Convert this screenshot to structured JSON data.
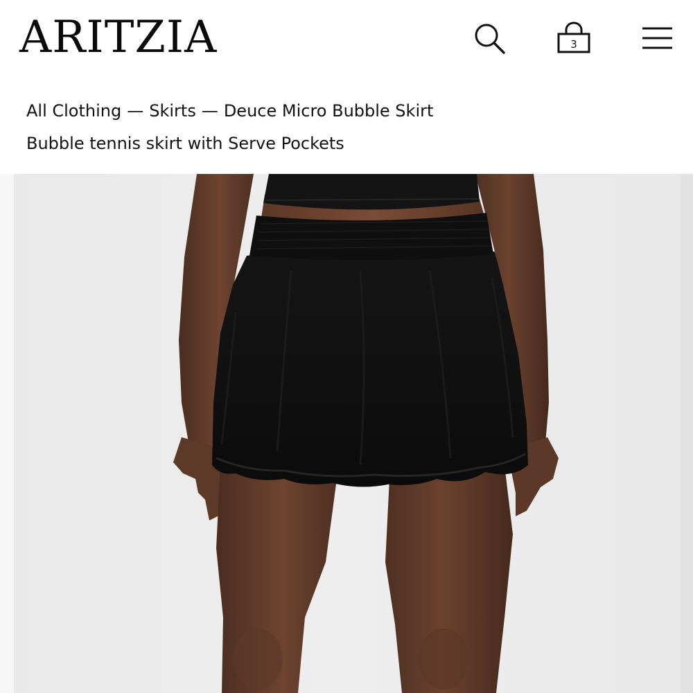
{
  "header": {
    "logo": "ARITZIA",
    "bag_count": "3",
    "icons": {
      "search": "search-icon",
      "bag": "shopping-bag-icon",
      "menu": "hamburger-menu-icon"
    }
  },
  "breadcrumb": {
    "items": [
      "All Clothing",
      "Skirts",
      "Deuce Micro Bubble Skirt"
    ],
    "separator": "—"
  },
  "product": {
    "subtitle": "Bubble tennis skirt with Serve Pockets",
    "image_description_colors": {
      "skirt": "#121212",
      "background": "#ececec"
    }
  }
}
